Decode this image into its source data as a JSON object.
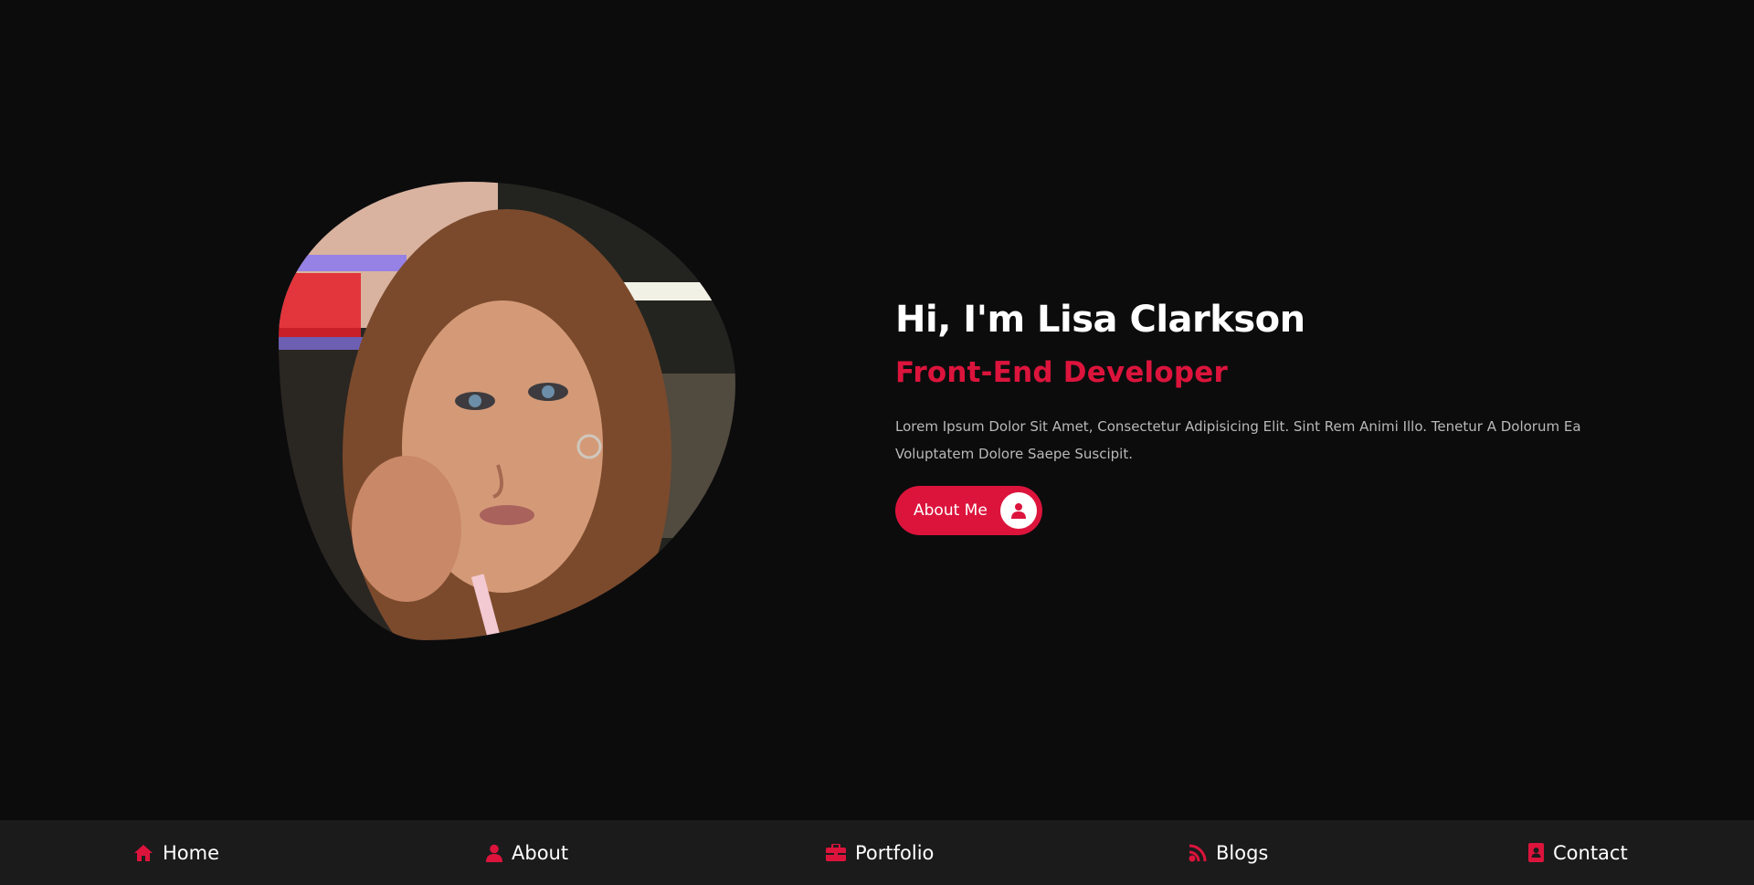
{
  "hero": {
    "greeting": "Hi, I'm Lisa Clarkson",
    "role": "Front-End Developer",
    "description": "Lorem Ipsum Dolor Sit Amet, Consectetur Adipisicing Elit. Sint Rem Animi Illo. Tenetur A Dolorum Ea Voluptatem Dolore Saepe Suscipit.",
    "about_button": {
      "label": "About Me",
      "icon": "user-icon"
    }
  },
  "nav": {
    "items": [
      {
        "label": "Home",
        "icon": "home-icon"
      },
      {
        "label": "About",
        "icon": "user-icon"
      },
      {
        "label": "Portfolio",
        "icon": "briefcase-icon"
      },
      {
        "label": "Blogs",
        "icon": "blog-icon"
      },
      {
        "label": "Contact",
        "icon": "contact-book-icon"
      }
    ]
  },
  "colors": {
    "accent": "#dc143c",
    "background": "#0c0c0d",
    "nav_background": "#1b1b1c",
    "text_muted": "#b9b9b9"
  }
}
